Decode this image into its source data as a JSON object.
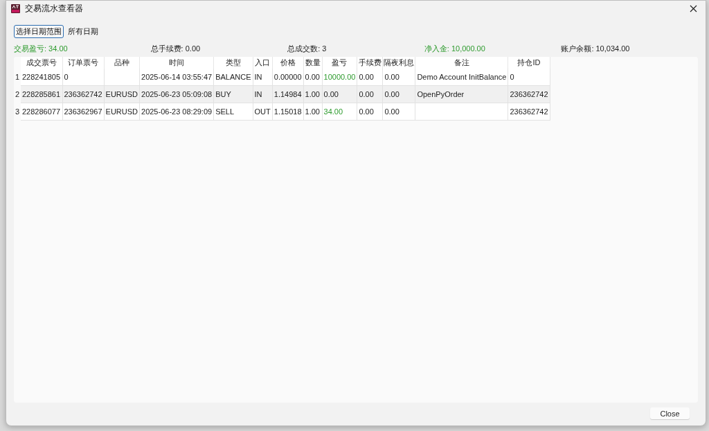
{
  "window": {
    "title": "交易流水查看器"
  },
  "toolbar": {
    "button": "选择日期范围",
    "range_label": "所有日期"
  },
  "summary": [
    {
      "text": "交易盈亏: 34.00",
      "positive": true
    },
    {
      "text": "总手续费: 0.00",
      "positive": false
    },
    {
      "text": "总成交数: 3",
      "positive": false
    },
    {
      "text": "净入金: 10,000.00",
      "positive": true
    },
    {
      "text": "账户余额: 10,034.00",
      "positive": false
    }
  ],
  "table": {
    "columns": [
      "成交票号",
      "订单票号",
      "品种",
      "时间",
      "类型",
      "入口",
      "价格",
      "数量",
      "盈亏",
      "手续费",
      "隔夜利息",
      "备注",
      "持仓ID"
    ],
    "rows": [
      {
        "index": "1",
        "cells": [
          "228241805",
          "0",
          "",
          "2025-06-14 03:55:47",
          "BALANCE",
          "IN",
          "0.00000",
          "0.00",
          "10000.00",
          "0.00",
          "0.00",
          "Demo Account InitBalance",
          "0"
        ],
        "pnl_positive": true
      },
      {
        "index": "2",
        "cells": [
          "228285861",
          "236362742",
          "EURUSD",
          "2025-06-23 05:09:08",
          "BUY",
          "IN",
          "1.14984",
          "1.00",
          "0.00",
          "0.00",
          "0.00",
          "OpenPyOrder",
          "236362742"
        ],
        "pnl_positive": false
      },
      {
        "index": "3",
        "cells": [
          "228286077",
          "236362967",
          "EURUSD",
          "2025-06-23 08:29:09",
          "SELL",
          "OUT",
          "1.15018",
          "1.00",
          "34.00",
          "0.00",
          "0.00",
          "",
          "236362742"
        ],
        "pnl_positive": true
      }
    ]
  },
  "footer": {
    "button": "Close"
  }
}
